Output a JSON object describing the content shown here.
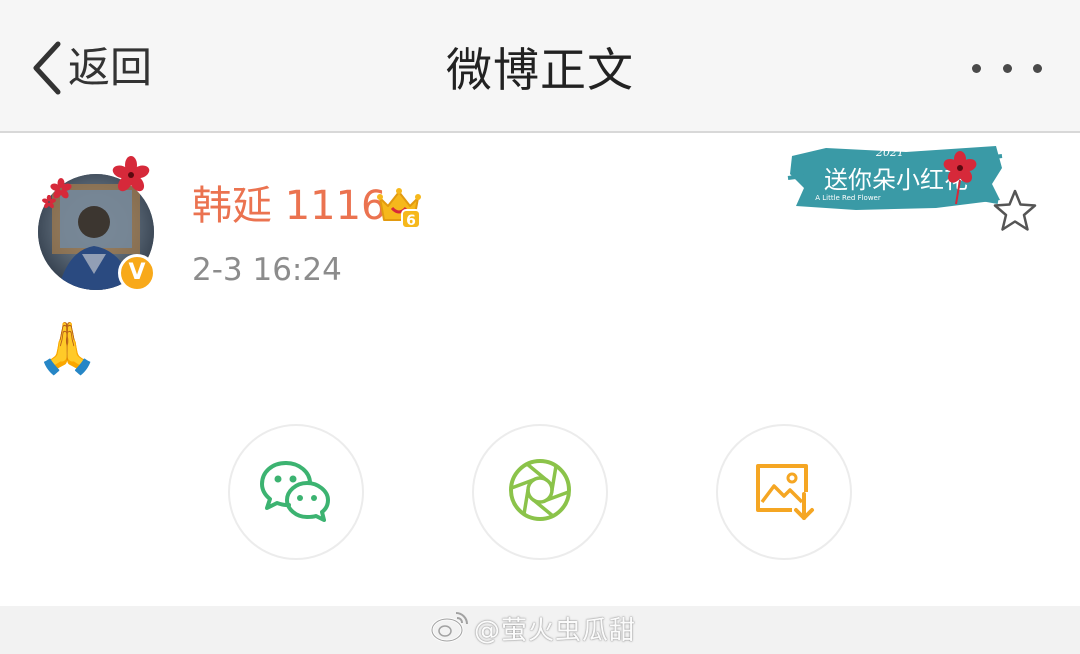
{
  "header": {
    "back_label": "返回",
    "title": "微博正文",
    "back_icon": "chevron-left-icon",
    "more_icon": "more-dots-icon"
  },
  "post": {
    "author": "韩延 1116",
    "timestamp": "2-3 16:24",
    "verified_badge": "V",
    "content": "🙏",
    "member_badge_level": "6"
  },
  "banner": {
    "year": "2021",
    "text": "送你朵小红花",
    "subtitle": "A Little Red Flower"
  },
  "share": {
    "buttons": [
      {
        "icon": "wechat-icon",
        "color": "#3cb371"
      },
      {
        "icon": "moments-icon",
        "color": "#8bc34a"
      },
      {
        "icon": "save-image-icon",
        "color": "#f5a623"
      }
    ]
  },
  "watermark": {
    "text": "@萤火虫瓜甜"
  },
  "colors": {
    "username": "#eb7350",
    "verified": "#f8a91a",
    "wechat": "#3cb371",
    "moments": "#8bc34a",
    "save": "#f5a623",
    "banner_teal": "#3a9aa6",
    "flower_red": "#d6293a"
  }
}
